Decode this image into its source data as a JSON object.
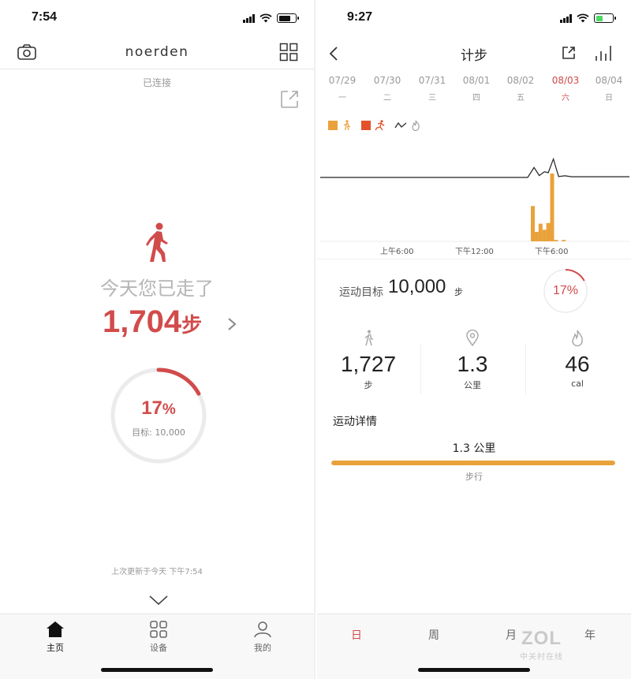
{
  "left": {
    "status": {
      "time": "7:54"
    },
    "header": {
      "brand": "noerden",
      "camera_icon": "camera-icon",
      "grid_icon": "grid-icon"
    },
    "connection_status": "已连接",
    "share_icon": "share-icon",
    "walked_label": "今天您已走了",
    "steps": {
      "value": "1,704",
      "unit": "步"
    },
    "ring": {
      "percent": "17",
      "percent_sign": "%",
      "goal_label": "目标: 10,000",
      "progress_fraction": 0.17,
      "color": "#d24b4b"
    },
    "last_updated": "上次更新于今天 下午7:54",
    "tabs": [
      {
        "label": "主页",
        "icon": "home-icon",
        "active": true
      },
      {
        "label": "设备",
        "icon": "devices-icon",
        "active": false
      },
      {
        "label": "我的",
        "icon": "profile-icon",
        "active": false
      }
    ]
  },
  "right": {
    "status": {
      "time": "9:27"
    },
    "header": {
      "title": "计步",
      "back_icon": "back-icon",
      "share_icon": "share-icon",
      "stats_icon": "bar-chart-icon"
    },
    "days": [
      {
        "date": "07/29",
        "weekday": "一"
      },
      {
        "date": "07/30",
        "weekday": "二"
      },
      {
        "date": "07/31",
        "weekday": "三"
      },
      {
        "date": "08/01",
        "weekday": "四"
      },
      {
        "date": "08/02",
        "weekday": "五"
      },
      {
        "date": "08/03",
        "weekday": "六",
        "selected": true
      },
      {
        "date": "08/04",
        "weekday": "日"
      }
    ],
    "legend": [
      {
        "color": "#e9a23b",
        "icon": "walking-icon"
      },
      {
        "color": "#e4522b",
        "icon": "running-icon"
      },
      {
        "color": "#333333",
        "icon": "calories-icon"
      }
    ],
    "chart_data": {
      "type": "bar",
      "x_tick_labels": [
        "上午6:00",
        "下午12:00",
        "下午6:00"
      ],
      "series": [
        {
          "kind": "bar",
          "color": "#e9a23b",
          "points": [
            {
              "hour": 16.5,
              "value": 0.52
            },
            {
              "hour": 16.8,
              "value": 0.14
            },
            {
              "hour": 17.1,
              "value": 0.26
            },
            {
              "hour": 17.4,
              "value": 0.17
            },
            {
              "hour": 17.7,
              "value": 0.27
            },
            {
              "hour": 18.0,
              "value": 1.0
            },
            {
              "hour": 18.3,
              "value": 0.02
            },
            {
              "hour": 18.9,
              "value": 0.02
            }
          ]
        },
        {
          "kind": "line",
          "color": "#222222",
          "points": [
            {
              "hour": 0,
              "value": 0
            },
            {
              "hour": 16.1,
              "value": 0
            },
            {
              "hour": 16.6,
              "value": 0.42
            },
            {
              "hour": 17.0,
              "value": 0.08
            },
            {
              "hour": 17.4,
              "value": 0.24
            },
            {
              "hour": 17.7,
              "value": 0.2
            },
            {
              "hour": 18.1,
              "value": 0.78
            },
            {
              "hour": 18.5,
              "value": 0.04
            },
            {
              "hour": 19.0,
              "value": 0.07
            },
            {
              "hour": 19.5,
              "value": 0.03
            },
            {
              "hour": 24,
              "value": 0.03
            }
          ]
        }
      ],
      "xlim": [
        0,
        24
      ],
      "ylim": [
        0,
        1
      ]
    },
    "goal": {
      "label": "运动目标",
      "value": "10,000",
      "unit": "步"
    },
    "ring": {
      "percent": "17%",
      "progress_fraction": 0.17,
      "color": "#d24b4b"
    },
    "metrics": [
      {
        "icon": "walking-icon",
        "value": "1,727",
        "unit": "步"
      },
      {
        "icon": "location-pin-icon",
        "value": "1.3",
        "unit": "公里"
      },
      {
        "icon": "flame-icon",
        "value": "46",
        "unit": "cal"
      }
    ],
    "detail": {
      "title": "运动详情",
      "distance": "1.3 公里",
      "mode": "步行",
      "progress_fraction": 1.0,
      "bar_color": "#e9a23b"
    },
    "tabs": [
      {
        "label": "日",
        "active": true
      },
      {
        "label": "周",
        "active": false
      },
      {
        "label": "月",
        "active": false
      },
      {
        "label": "年",
        "active": false
      }
    ],
    "watermark": {
      "line1": "ZOL",
      "line2": "中关村在线"
    }
  }
}
